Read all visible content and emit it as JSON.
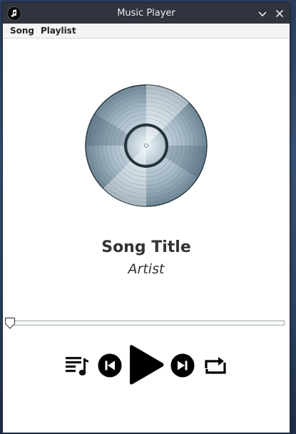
{
  "window": {
    "title": "Music Player",
    "app_icon": "music-note-icon",
    "controls": [
      "minimize-icon",
      "close-icon"
    ]
  },
  "menu": {
    "items": [
      {
        "label": "Song"
      },
      {
        "label": "Playlist"
      }
    ]
  },
  "now_playing": {
    "album_art": "vinyl-record-image",
    "title": "Song Title",
    "artist": "Artist",
    "progress": 0
  },
  "controls": {
    "icons": [
      "playlist-icon",
      "previous-icon",
      "play-icon",
      "next-icon",
      "repeat-icon"
    ]
  },
  "colors": {
    "titlebar": "#2f343f",
    "accent": "#000000",
    "text": "#333333"
  }
}
